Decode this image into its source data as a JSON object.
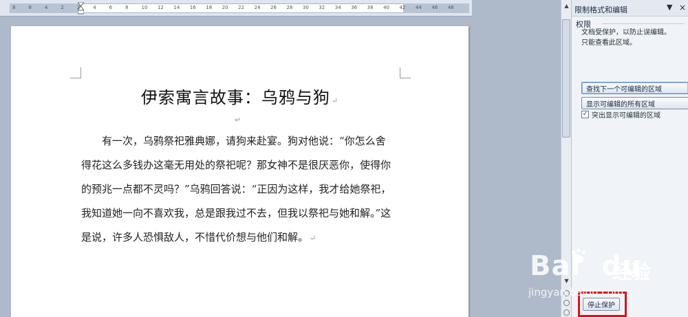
{
  "ruler": {
    "numbers": [
      "8",
      "6",
      "4",
      "2",
      "2",
      "4",
      "6",
      "8",
      "10",
      "12",
      "14",
      "16",
      "18",
      "20",
      "22",
      "24",
      "26",
      "28",
      "30",
      "32",
      "34",
      "36",
      "38",
      "40",
      "42",
      "44",
      "46",
      "48"
    ]
  },
  "document": {
    "title": "伊索寓言故事：乌鸦与狗",
    "paragraph_mark": "↵",
    "body_lines": [
      "　　有一次，乌鸦祭祀雅典娜，请狗来赴宴。狗对他说：“你怎么舍",
      "得花这么多钱办这毫无用处的祭祀呢？那女神不是很厌恶你，使得你",
      "的预兆一点都不灵吗？”乌鸦回答说：“正因为这样，我才给她祭祀，",
      "我知道她一向不喜欢我，总是跟我过不去，但我以祭祀与她和解。”这",
      "是说，许多人恐惧敌人，不惜代价想与他们和解。"
    ]
  },
  "pane": {
    "title": "限制格式和编辑",
    "section_label": "权限",
    "desc_line1": "文档受保护，以防止误编辑。",
    "desc_line2": "只能查看此区域。",
    "btn_find": "查找下一个可编辑的区域",
    "btn_showall": "显示可编辑的所有区域",
    "checkbox_label": "突出显示可编辑的区域",
    "checkbox_checked": "✓",
    "btn_stop": "停止保护",
    "menu_icon": "▼",
    "close_icon": "×"
  },
  "colors": {
    "highlight": "#d7151b",
    "background": "#aeb9c9"
  },
  "watermark": {
    "brand": "Bai",
    "brand2": "du",
    "label": "经验",
    "url": "jingyan.baidu.com"
  }
}
